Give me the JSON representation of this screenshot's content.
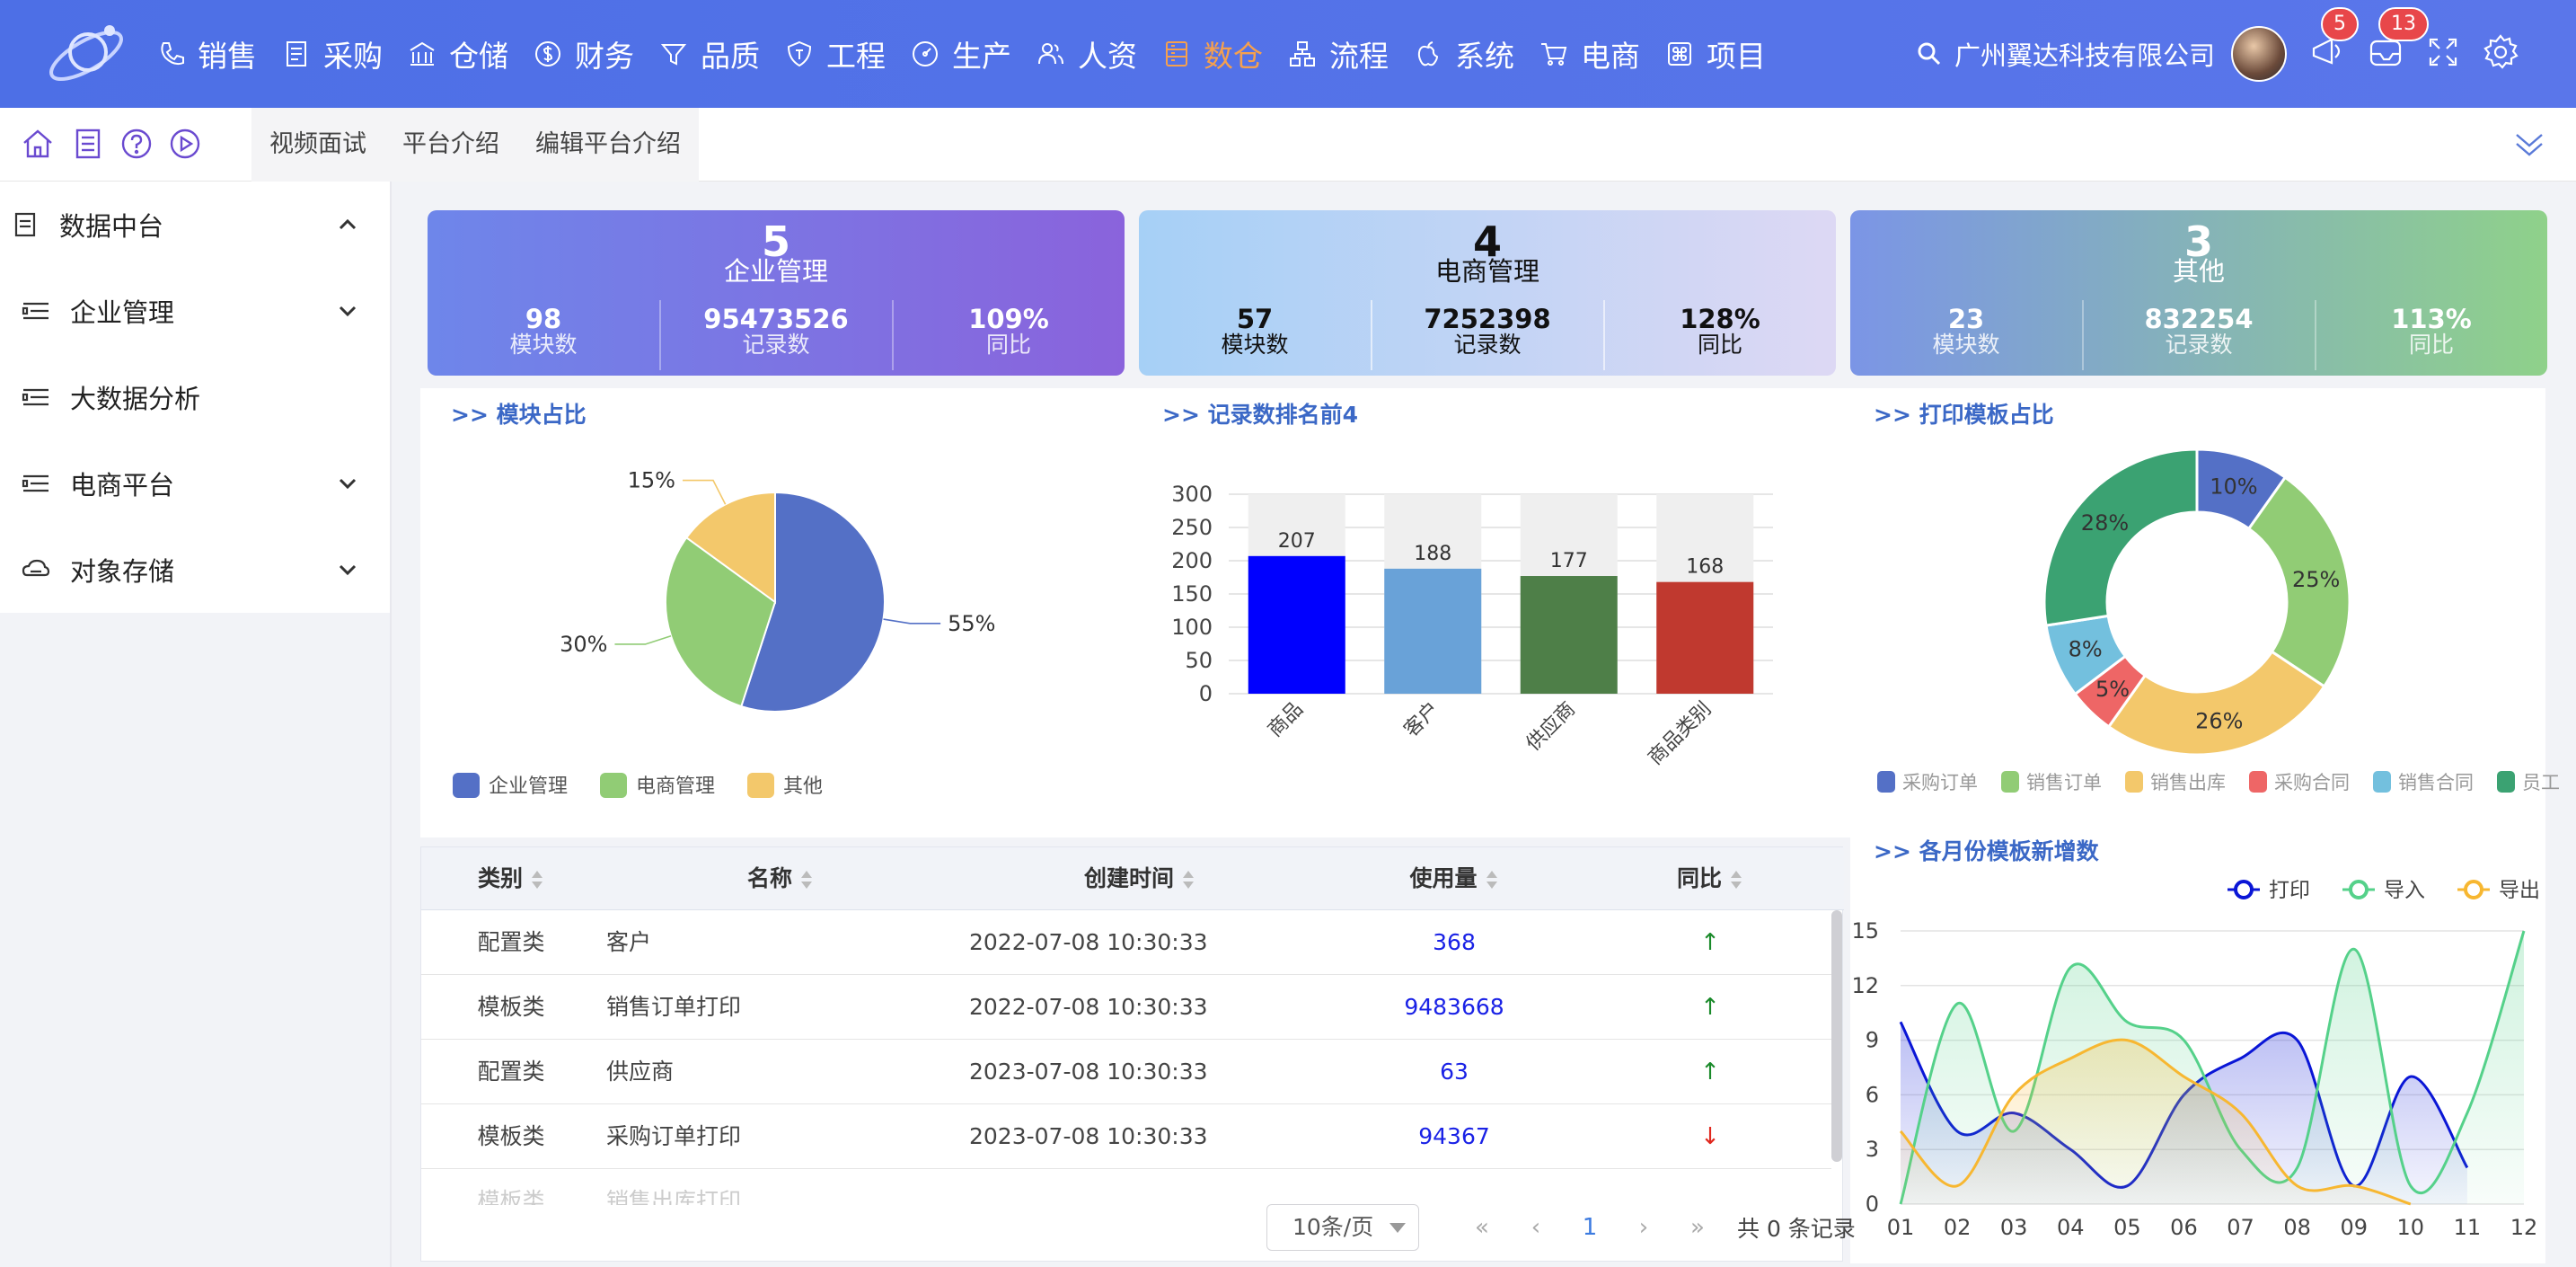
{
  "nav": {
    "items": [
      {
        "label": "销售",
        "icon": "phone-icon"
      },
      {
        "label": "采购",
        "icon": "document-icon"
      },
      {
        "label": "仓储",
        "icon": "warehouse-icon"
      },
      {
        "label": "财务",
        "icon": "dollar-icon"
      },
      {
        "label": "品质",
        "icon": "filter-icon"
      },
      {
        "label": "工程",
        "icon": "shield-icon"
      },
      {
        "label": "生产",
        "icon": "gauge-icon"
      },
      {
        "label": "人资",
        "icon": "people-icon"
      },
      {
        "label": "数仓",
        "icon": "database-icon",
        "active": true
      },
      {
        "label": "流程",
        "icon": "flow-icon"
      },
      {
        "label": "系统",
        "icon": "apple-icon"
      },
      {
        "label": "电商",
        "icon": "cart-icon"
      },
      {
        "label": "项目",
        "icon": "command-icon"
      }
    ],
    "active_color": "#f6a04d"
  },
  "header": {
    "company": "广州翼达科技有限公司",
    "badge_messages": "5",
    "badge_notifications": "13"
  },
  "tabs": [
    "视频面试",
    "平台介绍",
    "编辑平台介绍"
  ],
  "sidebar": {
    "items": [
      {
        "label": "数据中台",
        "expanded": true
      },
      {
        "label": "企业管理"
      },
      {
        "label": "大数据分析"
      },
      {
        "label": "电商平台"
      },
      {
        "label": "对象存储"
      }
    ]
  },
  "cards": [
    {
      "count": "5",
      "title": "企业管理",
      "stats": [
        {
          "value": "98",
          "label": "模块数"
        },
        {
          "value": "95473526",
          "label": "记录数"
        },
        {
          "value": "109%",
          "label": "同比"
        }
      ]
    },
    {
      "count": "4",
      "title": "电商管理",
      "stats": [
        {
          "value": "57",
          "label": "模块数"
        },
        {
          "value": "7252398",
          "label": "记录数"
        },
        {
          "value": "128%",
          "label": "同比"
        }
      ]
    },
    {
      "count": "3",
      "title": "其他",
      "stats": [
        {
          "value": "23",
          "label": "模块数"
        },
        {
          "value": "832254",
          "label": "记录数"
        },
        {
          "value": "113%",
          "label": "同比"
        }
      ]
    }
  ],
  "panels": {
    "module_share": ">> 模块占比",
    "top_records": ">> 记录数排名前4",
    "print_share": ">> 打印模板占比",
    "monthly": ">> 各月份模板新增数"
  },
  "table": {
    "headers": [
      "类别",
      "名称",
      "创建时间",
      "使用量",
      "同比"
    ],
    "rows": [
      {
        "category": "配置类",
        "name": "客户",
        "created": "2022-07-08 10:30:33",
        "usage": "368",
        "trend": "up"
      },
      {
        "category": "模板类",
        "name": "销售订单打印",
        "created": "2022-07-08 10:30:33",
        "usage": "9483668",
        "trend": "up"
      },
      {
        "category": "配置类",
        "name": "供应商",
        "created": "2023-07-08 10:30:33",
        "usage": "63",
        "trend": "up"
      },
      {
        "category": "模板类",
        "name": "采购订单打印",
        "created": "2023-07-08 10:30:33",
        "usage": "94367",
        "trend": "down"
      }
    ],
    "trend_up": "↑",
    "trend_down": "↓",
    "partial_row": {
      "category": "模板类",
      "name": "销售出库打印"
    }
  },
  "pager": {
    "page_size": "10条/页",
    "current": "1",
    "total": "共 0 条记录"
  },
  "chart_data": [
    {
      "type": "pie",
      "title": "",
      "slices": [
        {
          "name": "企业管理",
          "value": 55,
          "label": "55%",
          "color": "#5470c6"
        },
        {
          "name": "电商管理",
          "value": 30,
          "label": "30%",
          "color": "#91cc75"
        },
        {
          "name": "其他",
          "value": 15,
          "label": "15%",
          "color": "#f3c86b"
        }
      ]
    },
    {
      "type": "bar",
      "categories": [
        "商品",
        "客户",
        "供应商",
        "商品类别"
      ],
      "values": [
        207,
        188,
        177,
        168
      ],
      "colors": [
        "#0000ff",
        "#69a2d8",
        "#4e7f48",
        "#c0392f"
      ],
      "ylim": [
        0,
        300
      ],
      "yticks": [
        0,
        50,
        100,
        150,
        200,
        250,
        300
      ]
    },
    {
      "type": "pie",
      "subtype": "donut",
      "slices": [
        {
          "name": "采购订单",
          "value": 10,
          "label": "10%",
          "color": "#5470c6"
        },
        {
          "name": "销售订单",
          "value": 25,
          "label": "25%",
          "color": "#91cc75"
        },
        {
          "name": "销售出库",
          "value": 26,
          "label": "26%",
          "color": "#f3c86b"
        },
        {
          "name": "采购合同",
          "value": 5,
          "label": "5%",
          "color": "#ee6666"
        },
        {
          "name": "销售合同",
          "value": 8,
          "label": "8%",
          "color": "#73c0de"
        },
        {
          "name": "员工信息",
          "value": 28,
          "label": "28%",
          "color": "#3ba272"
        }
      ]
    },
    {
      "type": "line",
      "smooth": true,
      "x": [
        "01",
        "02",
        "03",
        "04",
        "05",
        "06",
        "07",
        "08",
        "09",
        "10",
        "11",
        "12"
      ],
      "ylim": [
        0,
        15
      ],
      "yticks": [
        0,
        3,
        6,
        9,
        12,
        15
      ],
      "series": [
        {
          "name": "打印",
          "color": "#0a16d6",
          "values": [
            10,
            4,
            5,
            3,
            1,
            6,
            8,
            9,
            1,
            7,
            2,
            null
          ]
        },
        {
          "name": "导入",
          "color": "#55d18a",
          "values": [
            0,
            11,
            4,
            13,
            10,
            9,
            3,
            2,
            14,
            1,
            5,
            15
          ]
        },
        {
          "name": "导出",
          "color": "#f7b731",
          "values": [
            4,
            1,
            6,
            8,
            9,
            7,
            5,
            1,
            1,
            0,
            null,
            null
          ]
        }
      ],
      "legend": "top-right"
    }
  ]
}
